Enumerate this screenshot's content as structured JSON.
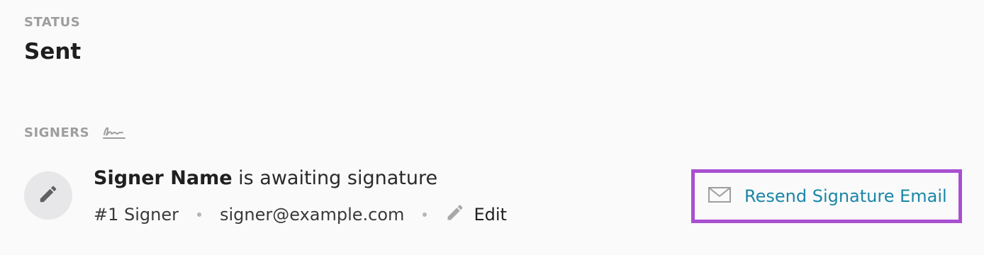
{
  "status": {
    "label": "STATUS",
    "value": "Sent"
  },
  "signers": {
    "label": "SIGNERS",
    "icon": "signature-icon",
    "items": [
      {
        "name": "Signer Name",
        "status_text": "is awaiting signature",
        "role": "#1 Signer",
        "email": "signer@example.com",
        "edit_label": "Edit",
        "avatar_icon": "pencil-icon"
      }
    ]
  },
  "actions": {
    "resend_label": "Resend Signature Email",
    "resend_icon": "envelope-icon",
    "highlight_color": "#a94fd1",
    "link_color": "#1a86a8"
  }
}
